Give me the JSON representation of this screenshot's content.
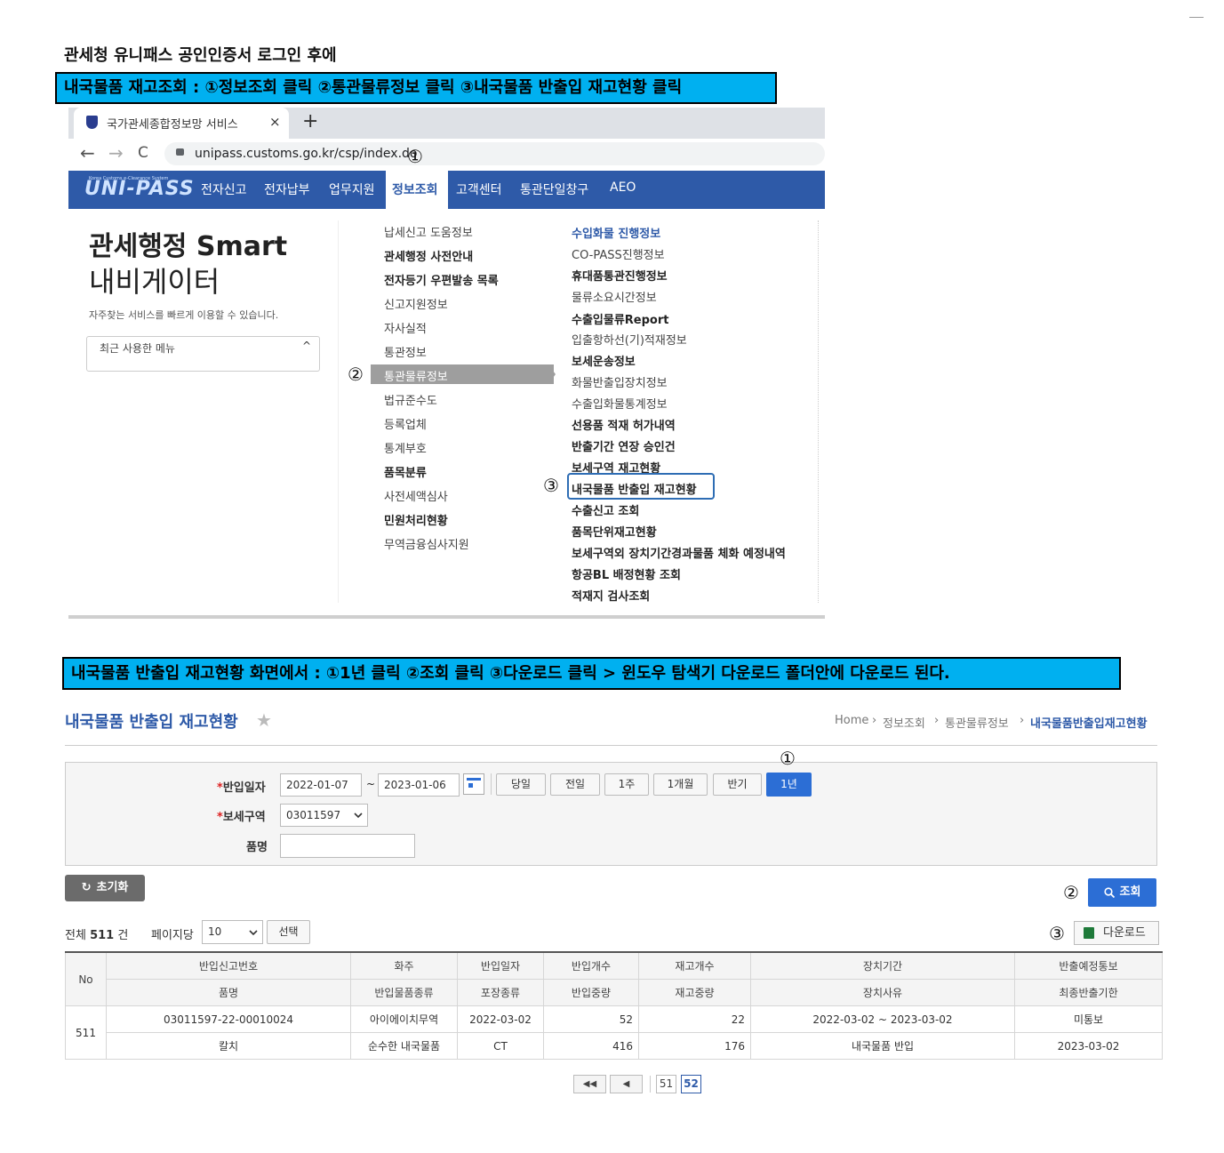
{
  "heading": "관세청 유니패스 공인인증서 로그인 후에",
  "banner1": "내국물품 재고조회 : ①정보조회 클릭 ②통관물류정보 클릭 ③내국물품 반출입 재고현황 클릭",
  "banner2": "내국물품 반출입 재고현황 화면에서 : ①1년 클릭 ②조회 클릭 ③다운로드 클릭 > 윈도우 탐색기 다운로드 폴더안에 다운로드 된다.",
  "markers": {
    "one": "①",
    "two": "②",
    "three": "③"
  },
  "browser": {
    "tab_title": "국가관세종합정보망 서비스",
    "tab_close": "×",
    "new_tab": "+",
    "back": "←",
    "forward": "→",
    "reload": "C",
    "url": "unipass.customs.go.kr/csp/index.do"
  },
  "site": {
    "logo": "UNI-PASS",
    "logo_sub": "Korea Customs e-Clearance System",
    "gnb": [
      "전자신고",
      "전자납부",
      "업무지원",
      "정보조회",
      "고객센터",
      "통관단일창구",
      "AEO"
    ],
    "smart_title": "관세행정 Smart",
    "smart_sub": "내비게이터",
    "smart_desc": "자주찾는 서비스를 빠르게 이용할 수 있습니다.",
    "recent_menu": "최근 사용한 메뉴",
    "recent_chevron": "^",
    "menu_col1": [
      "납세신고 도움정보",
      "관세행정 사전안내",
      "전자등기 우편발송 목록",
      "신고지원정보",
      "자사실적",
      "통관정보",
      "통관물류정보",
      "법규준수도",
      "등록업체",
      "통계부호",
      "품목분류",
      "사전세액심사",
      "민원처리현황",
      "무역금융심사지원"
    ],
    "menu_col2": [
      "수입화물 진행정보",
      "CO-PASS진행정보",
      "휴대품통관진행정보",
      "물류소요시간정보",
      "수출입물류Report",
      "입출항하선(기)적재정보",
      "보세운송정보",
      "화물반출입장치정보",
      "수출입화물통계정보",
      "선용품 적재 허가내역",
      "반출기간 연장 승인건",
      "보세구역 재고현황",
      "내국물품 반출입 재고현황",
      "수출신고 조회",
      "품목단위재고현황",
      "보세구역외 장치기간경과물품 체화 예정내역",
      "항공BL 배정현황 조회",
      "적재지 검사조회"
    ]
  },
  "page": {
    "title": "내국물품 반출입 재고현황",
    "star": "★",
    "breadcrumb": [
      "Home",
      "정보조회",
      "통관물류정보",
      "내국물품반출입재고현황"
    ],
    "breadcrumb_sep": "›",
    "form": {
      "date_label": "반입일자",
      "required_mark": "*",
      "date_from": "2022-01-07",
      "tilde": "~",
      "date_to": "2023-01-06",
      "quick": [
        "당일",
        "전일",
        "1주",
        "1개월",
        "반기",
        "1년"
      ],
      "zone_label": "보세구역",
      "zone_value": "03011597",
      "item_label": "품명",
      "item_value": ""
    },
    "reset": "초기화",
    "search": "조회",
    "total_prefix": "전체",
    "total_count": "511",
    "total_suffix": "건",
    "per_page_label": "페이지당",
    "per_page": "10",
    "select_btn": "선택",
    "download": "다운로드"
  },
  "table": {
    "head1": [
      "No",
      "반입신고번호",
      "화주",
      "반입일자",
      "반입개수",
      "재고개수",
      "장치기간",
      "반출예정통보"
    ],
    "head2": [
      "품명",
      "반입물품종류",
      "포장종류",
      "반입중량",
      "재고중량",
      "장치사유",
      "최종반출기한"
    ],
    "row1": [
      "511",
      "03011597-22-00010024",
      "아이에이치무역",
      "2022-03-02",
      "52",
      "22",
      "2022-03-02 ~ 2023-03-02",
      "미통보"
    ],
    "row2": [
      "칼치",
      "순수한 내국물품",
      "CT",
      "416",
      "176",
      "내국물품 반입",
      "2023-03-02"
    ]
  },
  "pager": {
    "first": "◀◀",
    "prev": "◀",
    "pages": [
      "51",
      "52"
    ],
    "current": "52"
  }
}
